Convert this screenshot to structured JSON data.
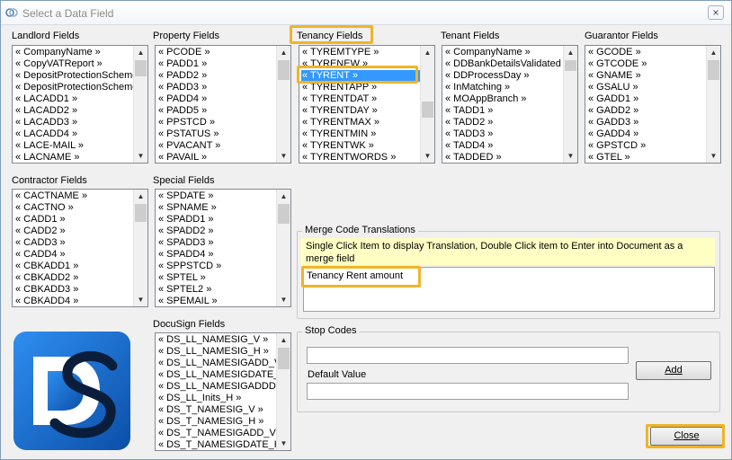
{
  "window": {
    "title": "Select a Data Field",
    "close_glyph": "×"
  },
  "landlord": {
    "label": "Landlord Fields",
    "items": [
      "« CompanyName »",
      "« CopyVATReport »",
      "« DepositProtectionScheme",
      "« DepositProtectionScheme",
      "« LACADD1 »",
      "« LACADD2 »",
      "« LACADD3 »",
      "« LACADD4 »",
      "« LACE-MAIL »",
      "« LACNAME »"
    ]
  },
  "property": {
    "label": "Property Fields",
    "items": [
      "« PCODE »",
      "« PADD1 »",
      "« PADD2 »",
      "« PADD3 »",
      "« PADD4 »",
      "« PADD5 »",
      "« PPSTCD »",
      "« PSTATUS »",
      "« PVACANT »",
      "« PAVAIL »"
    ]
  },
  "tenancy": {
    "label": "Tenancy Fields",
    "selected": "TYRENT",
    "items": [
      "« TYREMTYPE »",
      "« TYRENEW »",
      "« TYRENT »",
      "« TYRENTAPP »",
      "« TYRENTDAT »",
      "« TYRENTDAY »",
      "« TYRENTMAX »",
      "« TYRENTMIN »",
      "« TYRENTWK »",
      "« TYRENTWORDS »"
    ]
  },
  "tenant": {
    "label": "Tenant Fields",
    "items": [
      "« CompanyName »",
      "« DDBankDetailsValidated »",
      "« DDProcessDay »",
      "« InMatching »",
      "« MOAppBranch »",
      "« TADD1 »",
      "« TADD2 »",
      "« TADD3 »",
      "« TADD4 »",
      "« TADDED »"
    ]
  },
  "guarantor": {
    "label": "Guarantor Fields",
    "items": [
      "« GCODE »",
      "« GTCODE »",
      "« GNAME »",
      "« GSALU »",
      "« GADD1 »",
      "« GADD2 »",
      "« GADD3 »",
      "« GADD4 »",
      "« GPSTCD »",
      "« GTEL »"
    ]
  },
  "contractor": {
    "label": "Contractor Fields",
    "items": [
      "« CACTNAME »",
      "« CACTNO »",
      "« CADD1 »",
      "« CADD2 »",
      "« CADD3 »",
      "« CADD4 »",
      "« CBKADD1 »",
      "« CBKADD2 »",
      "« CBKADD3 »",
      "« CBKADD4 »"
    ]
  },
  "special": {
    "label": "Special Fields",
    "items": [
      "« SPDATE »",
      "« SPNAME »",
      "« SPADD1 »",
      "« SPADD2 »",
      "« SPADD3 »",
      "« SPADD4 »",
      "« SPPSTCD »",
      "« SPTEL »",
      "« SPTEL2 »",
      "« SPEMAIL »"
    ]
  },
  "docusign": {
    "label": "DocuSign Fields",
    "items": [
      "« DS_LL_NAMESIG_V »",
      "« DS_LL_NAMESIG_H »",
      "« DS_LL_NAMESIGADD_V",
      "« DS_LL_NAMESIGDATE_H",
      "« DS_LL_NAMESIGADDDA",
      "« DS_LL_Inits_H »",
      "« DS_T_NAMESIG_V »",
      "« DS_T_NAMESIG_H »",
      "« DS_T_NAMESIGADD_V »",
      "« DS_T_NAMESIGDATE_H"
    ]
  },
  "merge": {
    "title": "Merge Code Translations",
    "instructions": "Single Click Item to display Translation, Double Click item to Enter into Document as a merge field",
    "translation": "Tenancy Rent amount"
  },
  "stop_codes": {
    "title": "Stop Codes",
    "value": "",
    "default_label": "Default Value",
    "default_value": "",
    "add_button": "Add"
  },
  "close_button": "Close",
  "colors": {
    "highlight": "#f0b429",
    "selection": "#3399ff",
    "info_bg": "#ffffc4",
    "logo_blue": "#1a6fd1"
  },
  "icons": [
    "app-icon",
    "close-icon",
    "scroll-up-icon",
    "scroll-down-icon",
    "docusign-logo"
  ]
}
